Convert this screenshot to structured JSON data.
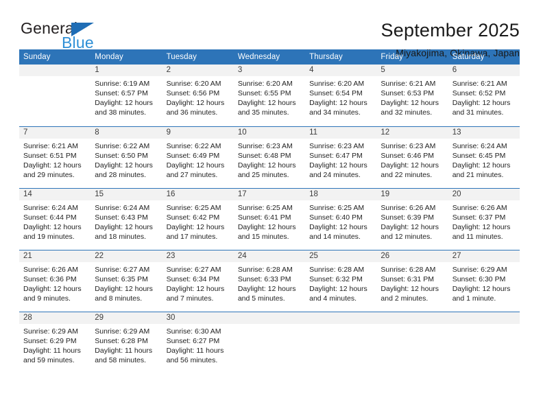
{
  "brand": {
    "word_one": "General",
    "word_two": "Blue",
    "triangle_icon": "blue-triangle-icon",
    "colors": {
      "general_text": "#231f20",
      "blue_text": "#2e8fd6",
      "triangle": "#1f6db5"
    }
  },
  "header": {
    "title": "September 2025",
    "subtitle": "Miyakojima, Okinawa, Japan"
  },
  "theme": {
    "header_row_bg": "#2d74b8",
    "daynum_bg": "#f2f2f2",
    "week_separator": "#2d74b8",
    "page_bg": "#ffffff"
  },
  "weekday_headers": [
    "Sunday",
    "Monday",
    "Tuesday",
    "Wednesday",
    "Thursday",
    "Friday",
    "Saturday"
  ],
  "weeks": [
    [
      {
        "day": "",
        "sunrise": "",
        "sunset": "",
        "daylight": "",
        "empty": true
      },
      {
        "day": "1",
        "sunrise": "Sunrise: 6:19 AM",
        "sunset": "Sunset: 6:57 PM",
        "daylight": "Daylight: 12 hours and 38 minutes."
      },
      {
        "day": "2",
        "sunrise": "Sunrise: 6:20 AM",
        "sunset": "Sunset: 6:56 PM",
        "daylight": "Daylight: 12 hours and 36 minutes."
      },
      {
        "day": "3",
        "sunrise": "Sunrise: 6:20 AM",
        "sunset": "Sunset: 6:55 PM",
        "daylight": "Daylight: 12 hours and 35 minutes."
      },
      {
        "day": "4",
        "sunrise": "Sunrise: 6:20 AM",
        "sunset": "Sunset: 6:54 PM",
        "daylight": "Daylight: 12 hours and 34 minutes."
      },
      {
        "day": "5",
        "sunrise": "Sunrise: 6:21 AM",
        "sunset": "Sunset: 6:53 PM",
        "daylight": "Daylight: 12 hours and 32 minutes."
      },
      {
        "day": "6",
        "sunrise": "Sunrise: 6:21 AM",
        "sunset": "Sunset: 6:52 PM",
        "daylight": "Daylight: 12 hours and 31 minutes."
      }
    ],
    [
      {
        "day": "7",
        "sunrise": "Sunrise: 6:21 AM",
        "sunset": "Sunset: 6:51 PM",
        "daylight": "Daylight: 12 hours and 29 minutes."
      },
      {
        "day": "8",
        "sunrise": "Sunrise: 6:22 AM",
        "sunset": "Sunset: 6:50 PM",
        "daylight": "Daylight: 12 hours and 28 minutes."
      },
      {
        "day": "9",
        "sunrise": "Sunrise: 6:22 AM",
        "sunset": "Sunset: 6:49 PM",
        "daylight": "Daylight: 12 hours and 27 minutes."
      },
      {
        "day": "10",
        "sunrise": "Sunrise: 6:23 AM",
        "sunset": "Sunset: 6:48 PM",
        "daylight": "Daylight: 12 hours and 25 minutes."
      },
      {
        "day": "11",
        "sunrise": "Sunrise: 6:23 AM",
        "sunset": "Sunset: 6:47 PM",
        "daylight": "Daylight: 12 hours and 24 minutes."
      },
      {
        "day": "12",
        "sunrise": "Sunrise: 6:23 AM",
        "sunset": "Sunset: 6:46 PM",
        "daylight": "Daylight: 12 hours and 22 minutes."
      },
      {
        "day": "13",
        "sunrise": "Sunrise: 6:24 AM",
        "sunset": "Sunset: 6:45 PM",
        "daylight": "Daylight: 12 hours and 21 minutes."
      }
    ],
    [
      {
        "day": "14",
        "sunrise": "Sunrise: 6:24 AM",
        "sunset": "Sunset: 6:44 PM",
        "daylight": "Daylight: 12 hours and 19 minutes."
      },
      {
        "day": "15",
        "sunrise": "Sunrise: 6:24 AM",
        "sunset": "Sunset: 6:43 PM",
        "daylight": "Daylight: 12 hours and 18 minutes."
      },
      {
        "day": "16",
        "sunrise": "Sunrise: 6:25 AM",
        "sunset": "Sunset: 6:42 PM",
        "daylight": "Daylight: 12 hours and 17 minutes."
      },
      {
        "day": "17",
        "sunrise": "Sunrise: 6:25 AM",
        "sunset": "Sunset: 6:41 PM",
        "daylight": "Daylight: 12 hours and 15 minutes."
      },
      {
        "day": "18",
        "sunrise": "Sunrise: 6:25 AM",
        "sunset": "Sunset: 6:40 PM",
        "daylight": "Daylight: 12 hours and 14 minutes."
      },
      {
        "day": "19",
        "sunrise": "Sunrise: 6:26 AM",
        "sunset": "Sunset: 6:39 PM",
        "daylight": "Daylight: 12 hours and 12 minutes."
      },
      {
        "day": "20",
        "sunrise": "Sunrise: 6:26 AM",
        "sunset": "Sunset: 6:37 PM",
        "daylight": "Daylight: 12 hours and 11 minutes."
      }
    ],
    [
      {
        "day": "21",
        "sunrise": "Sunrise: 6:26 AM",
        "sunset": "Sunset: 6:36 PM",
        "daylight": "Daylight: 12 hours and 9 minutes."
      },
      {
        "day": "22",
        "sunrise": "Sunrise: 6:27 AM",
        "sunset": "Sunset: 6:35 PM",
        "daylight": "Daylight: 12 hours and 8 minutes."
      },
      {
        "day": "23",
        "sunrise": "Sunrise: 6:27 AM",
        "sunset": "Sunset: 6:34 PM",
        "daylight": "Daylight: 12 hours and 7 minutes."
      },
      {
        "day": "24",
        "sunrise": "Sunrise: 6:28 AM",
        "sunset": "Sunset: 6:33 PM",
        "daylight": "Daylight: 12 hours and 5 minutes."
      },
      {
        "day": "25",
        "sunrise": "Sunrise: 6:28 AM",
        "sunset": "Sunset: 6:32 PM",
        "daylight": "Daylight: 12 hours and 4 minutes."
      },
      {
        "day": "26",
        "sunrise": "Sunrise: 6:28 AM",
        "sunset": "Sunset: 6:31 PM",
        "daylight": "Daylight: 12 hours and 2 minutes."
      },
      {
        "day": "27",
        "sunrise": "Sunrise: 6:29 AM",
        "sunset": "Sunset: 6:30 PM",
        "daylight": "Daylight: 12 hours and 1 minute."
      }
    ],
    [
      {
        "day": "28",
        "sunrise": "Sunrise: 6:29 AM",
        "sunset": "Sunset: 6:29 PM",
        "daylight": "Daylight: 11 hours and 59 minutes."
      },
      {
        "day": "29",
        "sunrise": "Sunrise: 6:29 AM",
        "sunset": "Sunset: 6:28 PM",
        "daylight": "Daylight: 11 hours and 58 minutes."
      },
      {
        "day": "30",
        "sunrise": "Sunrise: 6:30 AM",
        "sunset": "Sunset: 6:27 PM",
        "daylight": "Daylight: 11 hours and 56 minutes."
      },
      {
        "day": "",
        "sunrise": "",
        "sunset": "",
        "daylight": "",
        "empty": true
      },
      {
        "day": "",
        "sunrise": "",
        "sunset": "",
        "daylight": "",
        "empty": true
      },
      {
        "day": "",
        "sunrise": "",
        "sunset": "",
        "daylight": "",
        "empty": true
      },
      {
        "day": "",
        "sunrise": "",
        "sunset": "",
        "daylight": "",
        "empty": true
      }
    ]
  ]
}
